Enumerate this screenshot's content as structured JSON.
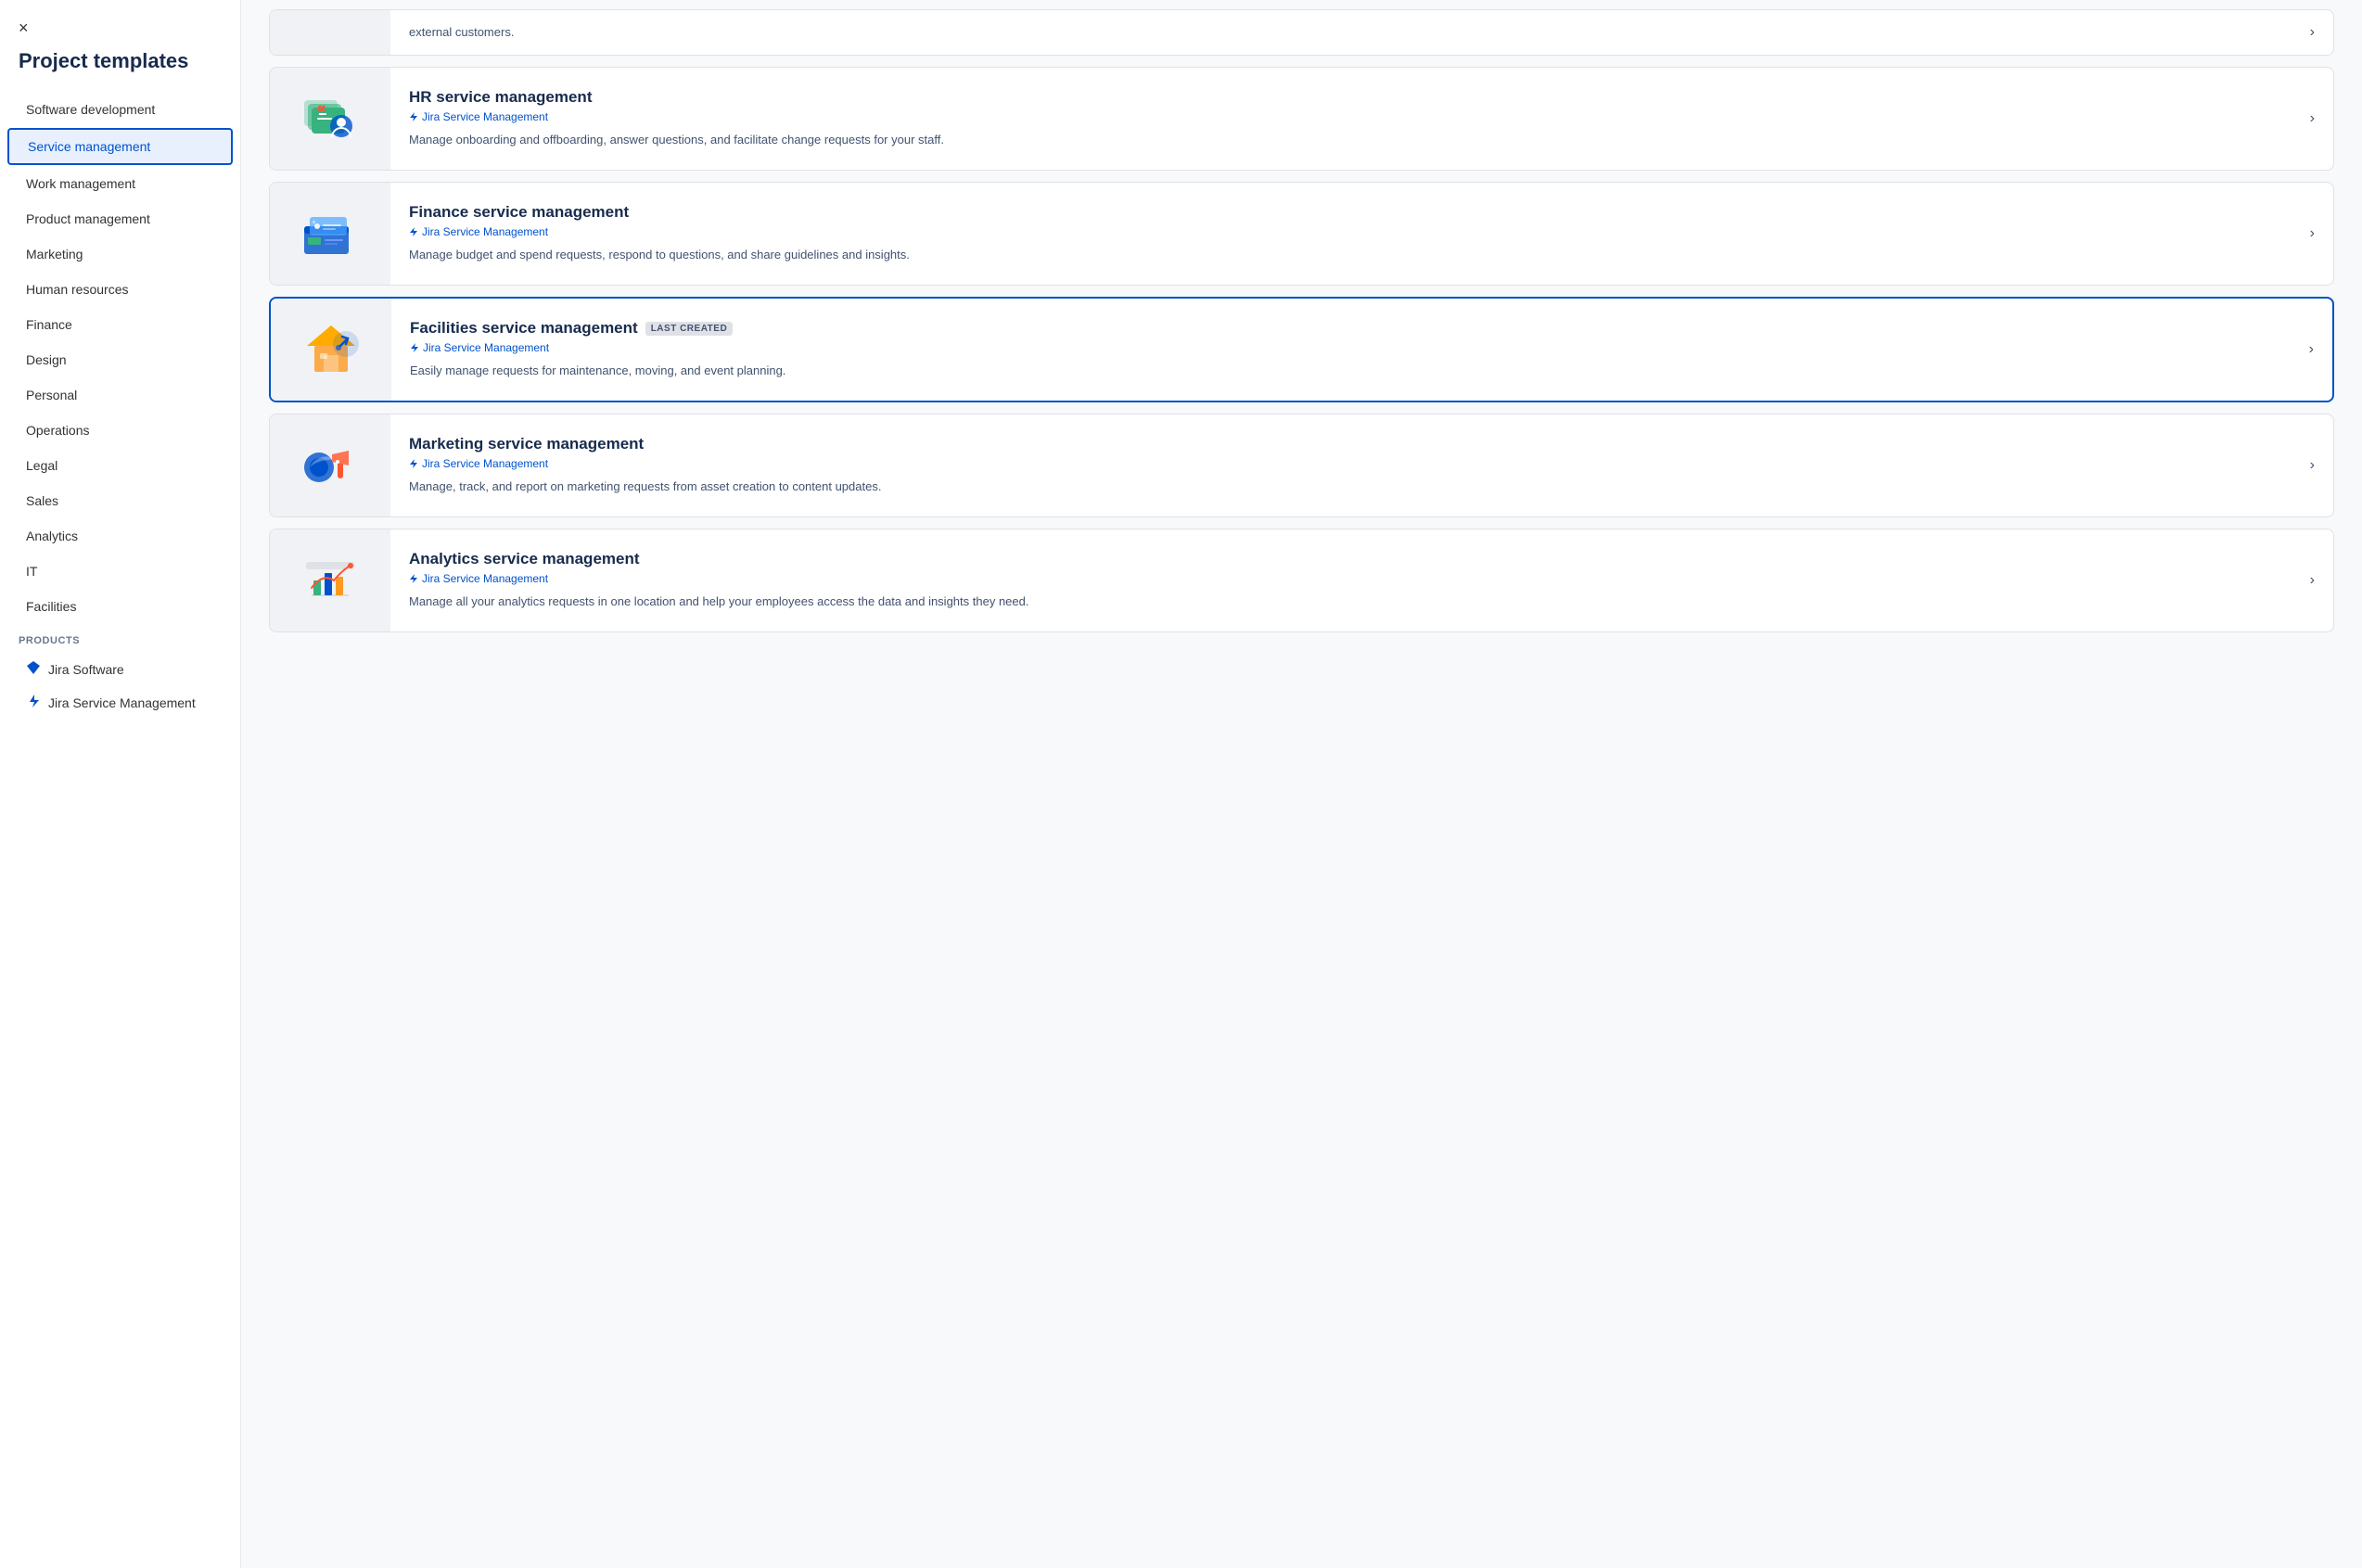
{
  "sidebar": {
    "title": "Project templates",
    "close_label": "×",
    "items": [
      {
        "id": "software-development",
        "label": "Software development",
        "active": false
      },
      {
        "id": "service-management",
        "label": "Service management",
        "active": true
      },
      {
        "id": "work-management",
        "label": "Work management",
        "active": false
      },
      {
        "id": "product-management",
        "label": "Product management",
        "active": false
      },
      {
        "id": "marketing",
        "label": "Marketing",
        "active": false
      },
      {
        "id": "human-resources",
        "label": "Human resources",
        "active": false
      },
      {
        "id": "finance",
        "label": "Finance",
        "active": false
      },
      {
        "id": "design",
        "label": "Design",
        "active": false
      },
      {
        "id": "personal",
        "label": "Personal",
        "active": false
      },
      {
        "id": "operations",
        "label": "Operations",
        "active": false
      },
      {
        "id": "legal",
        "label": "Legal",
        "active": false
      },
      {
        "id": "sales",
        "label": "Sales",
        "active": false
      },
      {
        "id": "analytics",
        "label": "Analytics",
        "active": false
      },
      {
        "id": "it",
        "label": "IT",
        "active": false
      },
      {
        "id": "facilities",
        "label": "Facilities",
        "active": false
      }
    ],
    "products_section_label": "PRODUCTS",
    "products": [
      {
        "id": "jira-software",
        "label": "Jira Software",
        "icon": "diamond"
      },
      {
        "id": "jira-service-management",
        "label": "Jira Service Management",
        "icon": "lightning"
      }
    ]
  },
  "main": {
    "partial_card": {
      "description": "external customers."
    },
    "templates": [
      {
        "id": "hr-service-management",
        "title": "HR service management",
        "source": "Jira Service Management",
        "description": "Manage onboarding and offboarding, answer questions, and facilitate change requests for your staff.",
        "highlighted": false,
        "badge": null
      },
      {
        "id": "finance-service-management",
        "title": "Finance service management",
        "source": "Jira Service Management",
        "description": "Manage budget and spend requests, respond to questions, and share guidelines and insights.",
        "highlighted": false,
        "badge": null
      },
      {
        "id": "facilities-service-management",
        "title": "Facilities service management",
        "source": "Jira Service Management",
        "description": "Easily manage requests for maintenance, moving, and event planning.",
        "highlighted": true,
        "badge": "LAST CREATED"
      },
      {
        "id": "marketing-service-management",
        "title": "Marketing service management",
        "source": "Jira Service Management",
        "description": "Manage, track, and report on marketing requests from asset creation to content updates.",
        "highlighted": false,
        "badge": null
      },
      {
        "id": "analytics-service-management",
        "title": "Analytics service management",
        "source": "Jira Service Management",
        "description": "Manage all your analytics requests in one location and help your employees access the data and insights they need.",
        "highlighted": false,
        "badge": null
      }
    ],
    "chevron_label": "›"
  }
}
